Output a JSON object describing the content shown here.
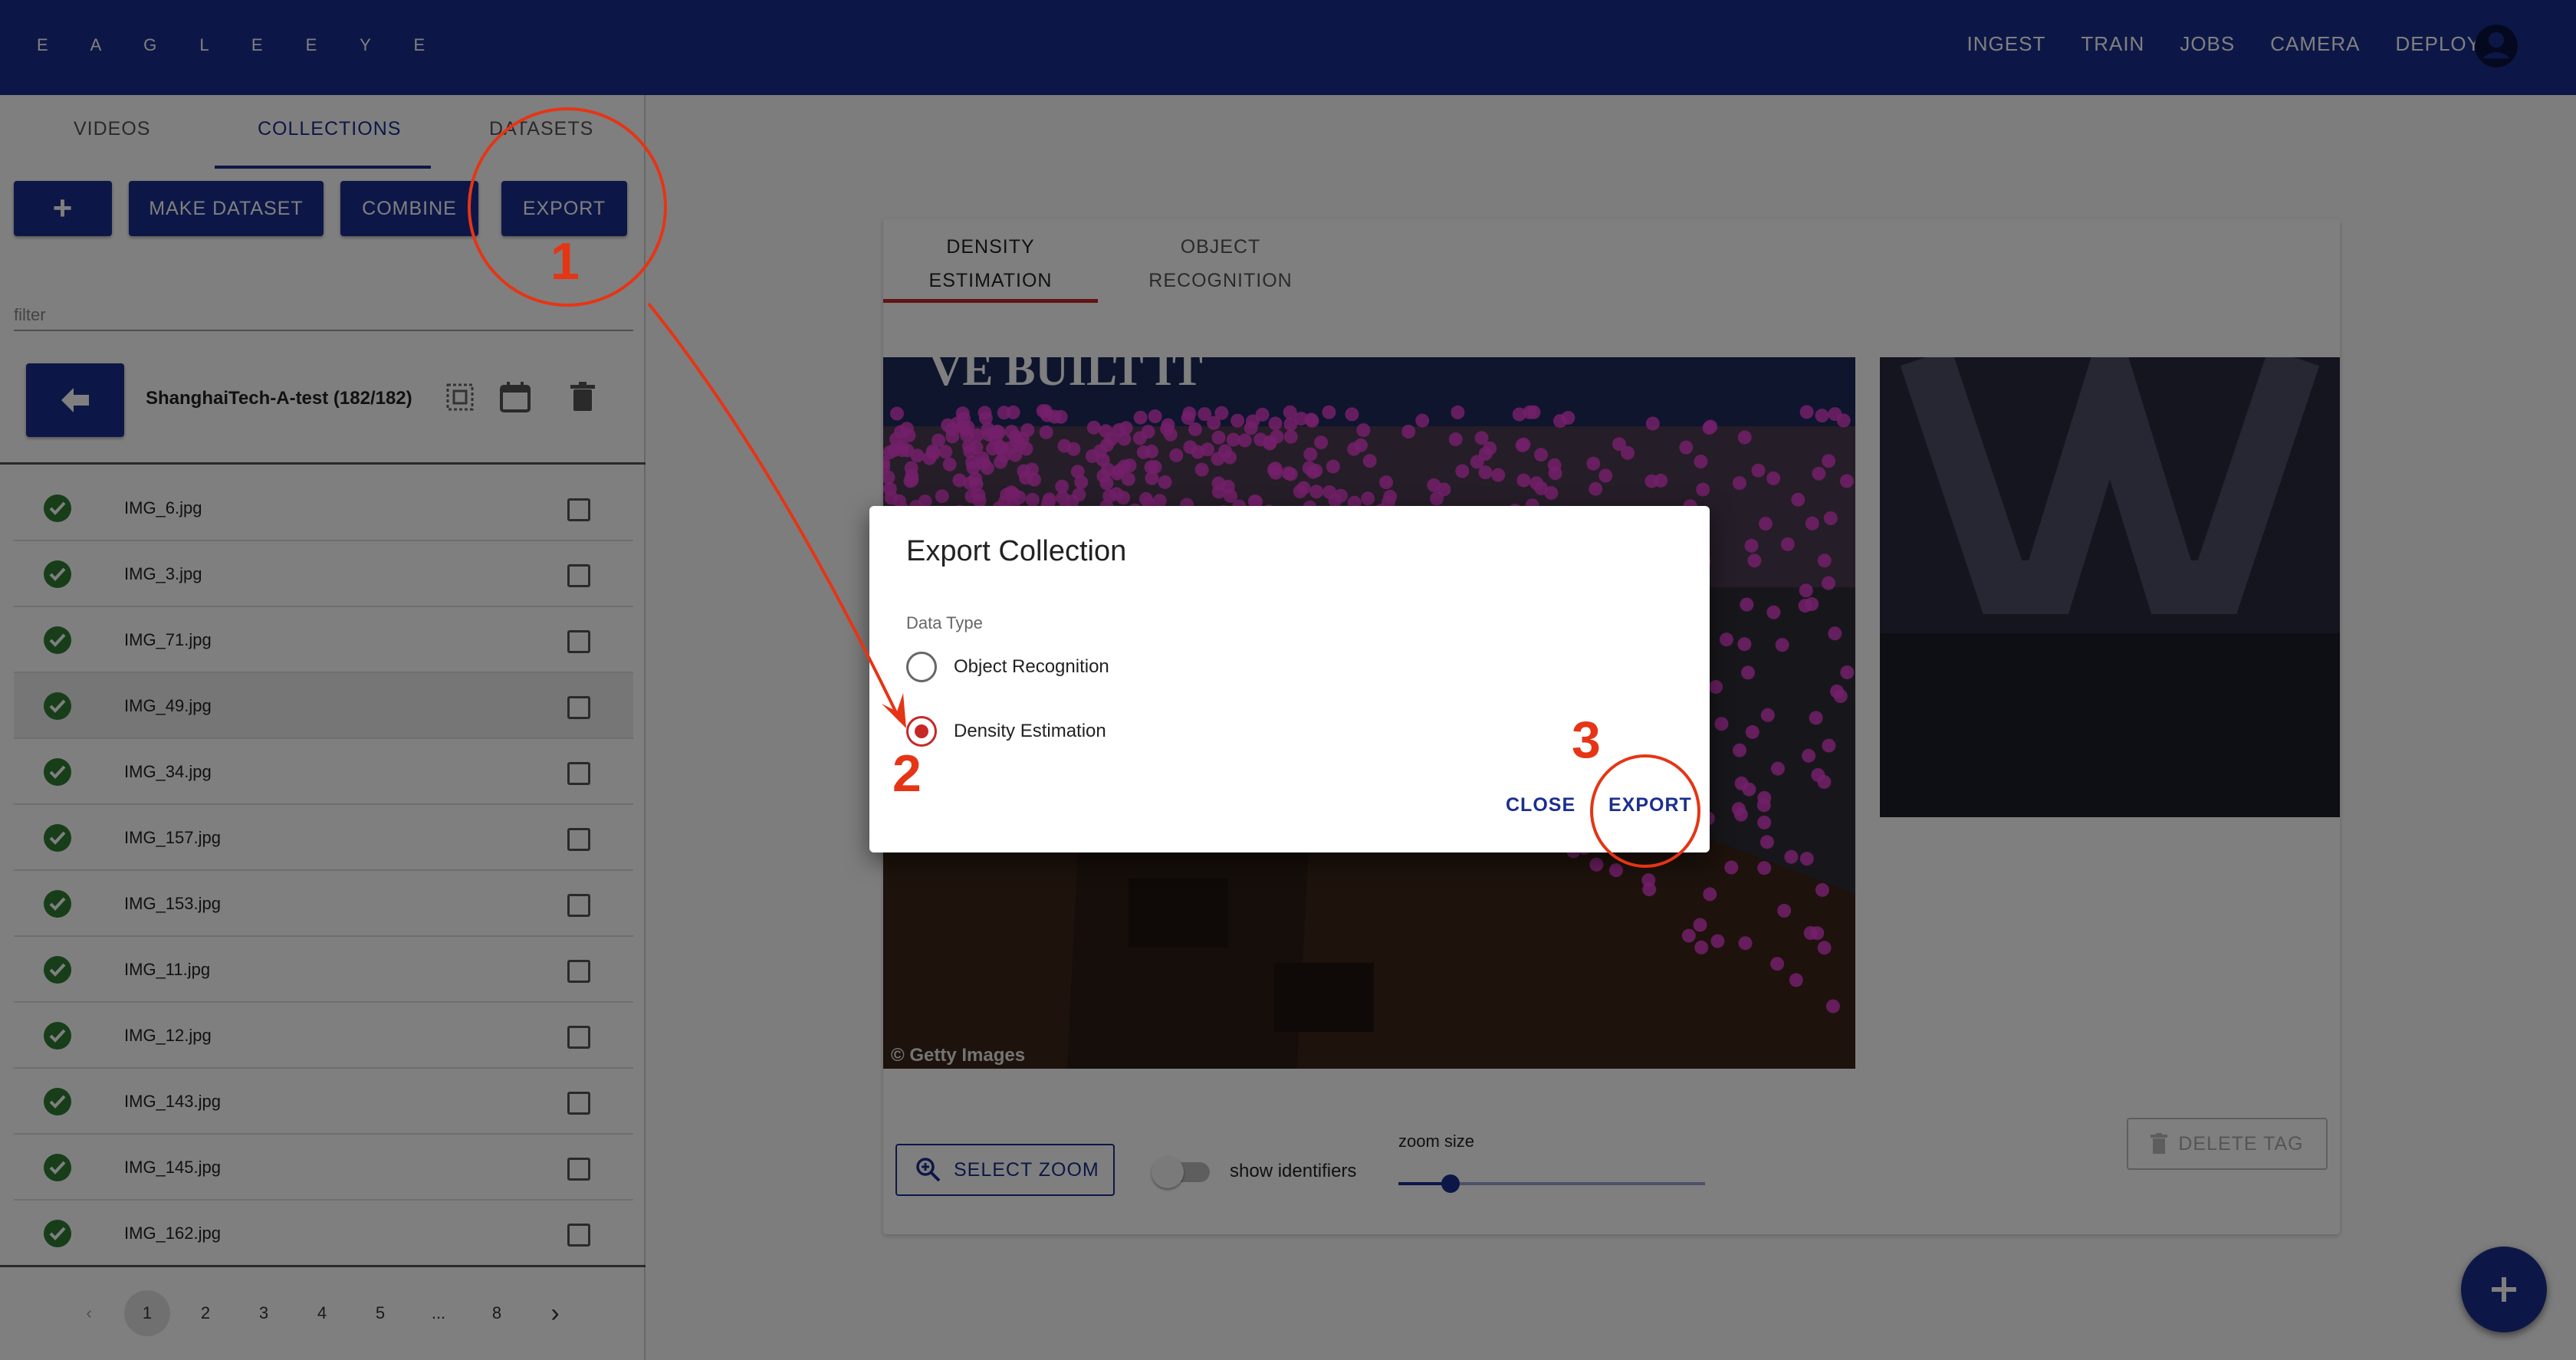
{
  "app": {
    "brand": "E A G L E   E Y E",
    "nav": [
      "INGEST",
      "TRAIN",
      "JOBS",
      "CAMERA",
      "DEPLOY"
    ]
  },
  "sidebar": {
    "tabs": [
      "VIDEOS",
      "COLLECTIONS",
      "DATASETS"
    ],
    "active_tab": "COLLECTIONS",
    "buttons": {
      "add": "+",
      "make_dataset": "MAKE DATASET",
      "combine": "COMBINE",
      "export": "EXPORT"
    },
    "filter_placeholder": "filter",
    "collection_title": "ShanghaiTech-A-test (182/182)",
    "files": [
      "IMG_6.jpg",
      "IMG_3.jpg",
      "IMG_71.jpg",
      "IMG_49.jpg",
      "IMG_34.jpg",
      "IMG_157.jpg",
      "IMG_153.jpg",
      "IMG_11.jpg",
      "IMG_12.jpg",
      "IMG_143.jpg",
      "IMG_145.jpg",
      "IMG_162.jpg"
    ],
    "highlighted_file": "IMG_49.jpg",
    "pagination": [
      "1",
      "2",
      "3",
      "4",
      "5",
      "...",
      "8"
    ],
    "current_page": "1"
  },
  "main": {
    "tabs": [
      {
        "line1": "DENSITY",
        "line2": "ESTIMATION"
      },
      {
        "line1": "OBJECT",
        "line2": "RECOGNITION"
      }
    ],
    "active_tab": "DENSITY ESTIMATION",
    "image_credit": "© Getty Images",
    "banner_text": "VE BUILT IT",
    "select_zoom": "SELECT ZOOM",
    "show_identifiers": "show identifiers",
    "show_identifiers_on": false,
    "zoom_size_label": "zoom size",
    "zoom_size_fraction": 0.08,
    "delete_tag": "DELETE TAG"
  },
  "dialog": {
    "title": "Export Collection",
    "data_type_label": "Data Type",
    "options": [
      "Object Recognition",
      "Density Estimation"
    ],
    "selected": "Density Estimation",
    "close": "CLOSE",
    "export": "EXPORT"
  },
  "annotations": {
    "step1": "1",
    "step2": "2",
    "step3": "3"
  },
  "colors": {
    "primary": "#1b2f8e",
    "accent_red": "#c62828",
    "annotation": "#e53515",
    "ok_green": "#2e7d32",
    "dot_magenta": "#e63fd4"
  }
}
